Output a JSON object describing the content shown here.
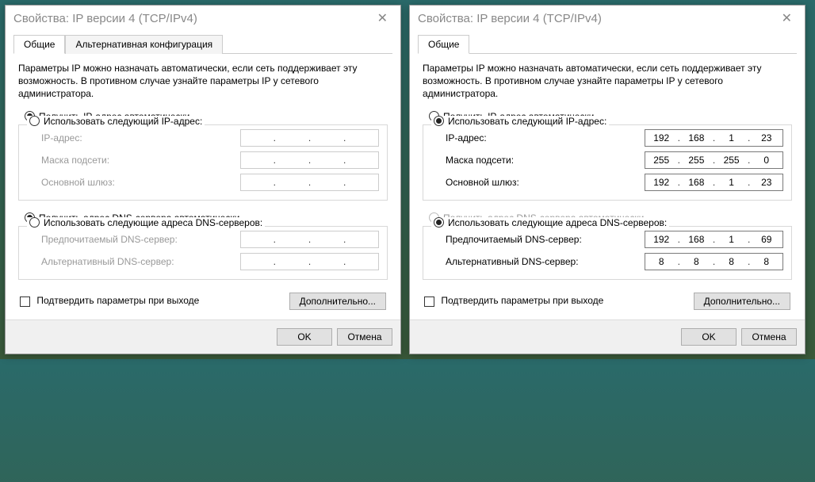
{
  "left": {
    "title": "Свойства: IP версии 4 (TCP/IPv4)",
    "tabs": {
      "general": "Общие",
      "alt": "Альтернативная конфигурация"
    },
    "desc": "Параметры IP можно назначать автоматически, если сеть поддерживает эту возможность. В противном случае узнайте параметры IP у сетевого администратора.",
    "ip": {
      "auto_label": "Получить IP-адрес автоматически",
      "manual_label": "Использовать следующий IP-адрес:",
      "selected": "auto",
      "addr_label": "IP-адрес:",
      "mask_label": "Маска подсети:",
      "gw_label": "Основной шлюз:",
      "addr": [
        "",
        "",
        "",
        ""
      ],
      "mask": [
        "",
        "",
        "",
        ""
      ],
      "gw": [
        "",
        "",
        "",
        ""
      ]
    },
    "dns": {
      "auto_label": "Получить адрес DNS-сервера автоматически",
      "manual_label": "Использовать следующие адреса DNS-серверов:",
      "selected": "auto",
      "pref_label": "Предпочитаемый DNS-сервер:",
      "alt_label": "Альтернативный DNS-сервер:",
      "pref": [
        "",
        "",
        "",
        ""
      ],
      "alt": [
        "",
        "",
        "",
        ""
      ]
    },
    "confirm_label": "Подтвердить параметры при выходе",
    "advanced_label": "Дополнительно...",
    "ok": "OK",
    "cancel": "Отмена"
  },
  "right": {
    "title": "Свойства: IP версии 4 (TCP/IPv4)",
    "tabs": {
      "general": "Общие"
    },
    "desc": "Параметры IP можно назначать автоматически, если сеть поддерживает эту возможность. В противном случае узнайте параметры IP у сетевого администратора.",
    "ip": {
      "auto_label": "Получить IP-адрес автоматически",
      "manual_label": "Использовать следующий IP-адрес:",
      "selected": "manual",
      "addr_label": "IP-адрес:",
      "mask_label": "Маска подсети:",
      "gw_label": "Основной шлюз:",
      "addr": [
        "192",
        "168",
        "1",
        "23"
      ],
      "mask": [
        "255",
        "255",
        "255",
        "0"
      ],
      "gw": [
        "192",
        "168",
        "1",
        "23"
      ]
    },
    "dns": {
      "auto_label": "Получить адрес DNS-сервера автоматически",
      "manual_label": "Использовать следующие адреса DNS-серверов:",
      "selected": "manual",
      "auto_disabled": true,
      "pref_label": "Предпочитаемый DNS-сервер:",
      "alt_label": "Альтернативный DNS-сервер:",
      "pref": [
        "192",
        "168",
        "1",
        "69"
      ],
      "alt": [
        "8",
        "8",
        "8",
        "8"
      ]
    },
    "confirm_label": "Подтвердить параметры при выходе",
    "advanced_label": "Дополнительно...",
    "ok": "OK",
    "cancel": "Отмена"
  }
}
